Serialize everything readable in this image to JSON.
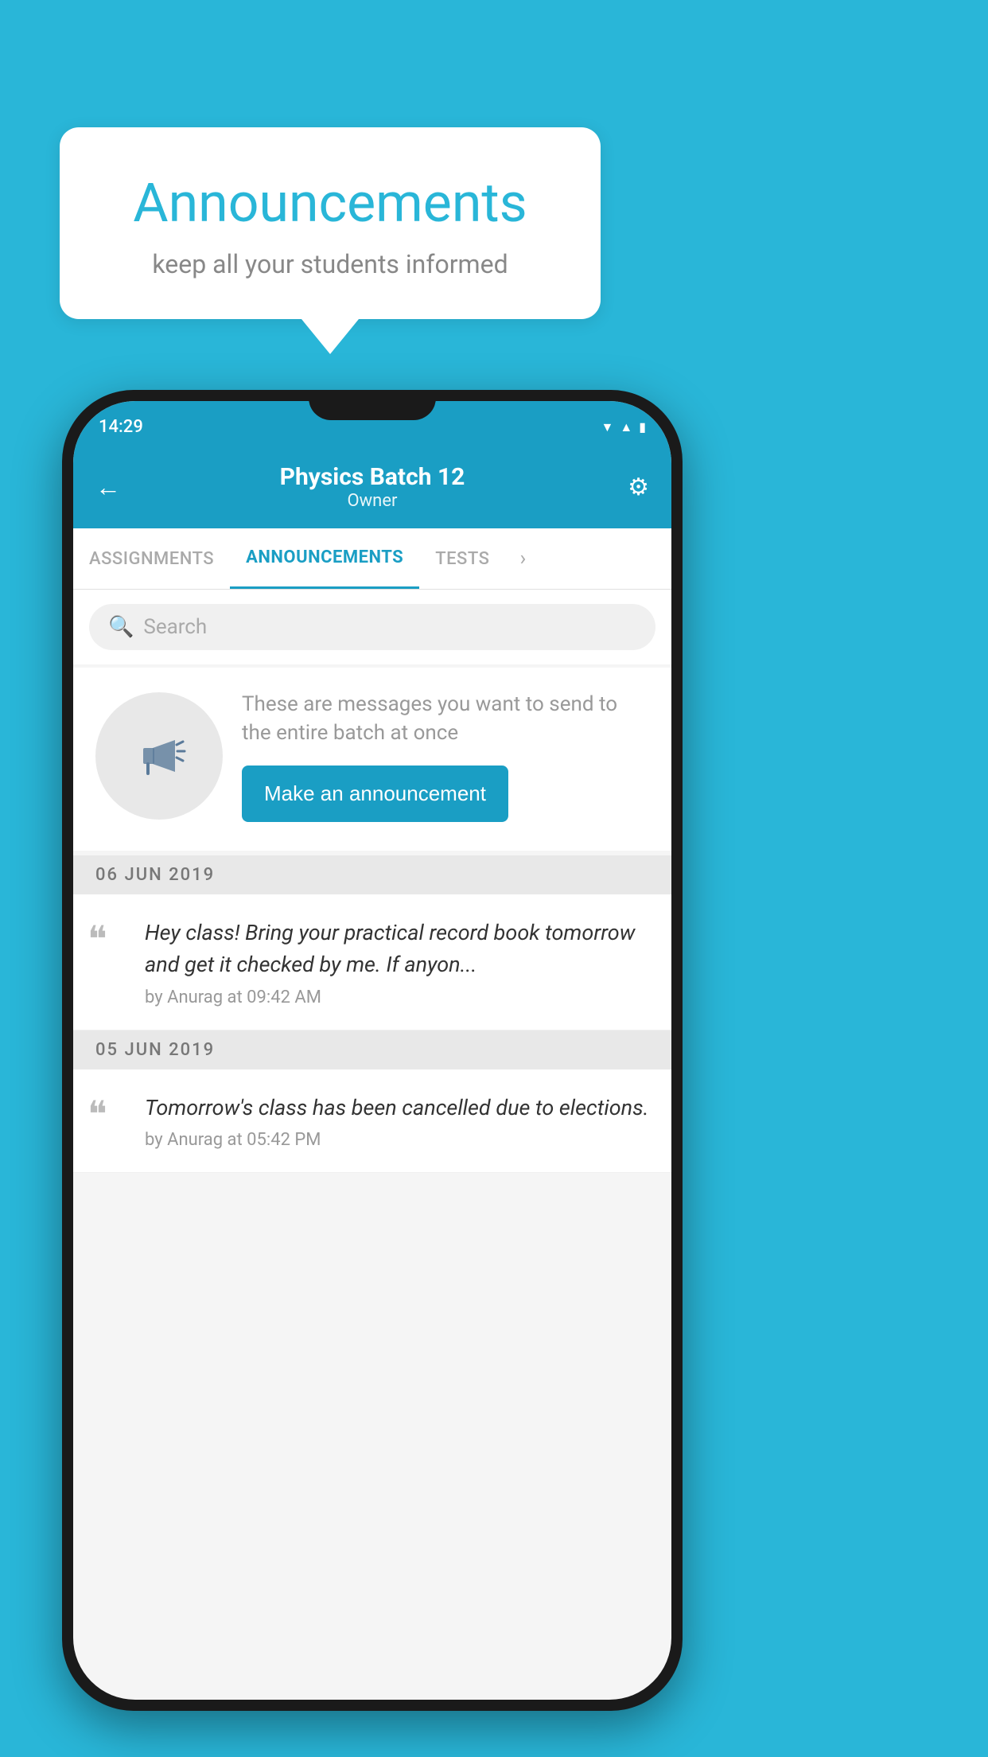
{
  "background_color": "#29b6d8",
  "speech_bubble": {
    "title": "Announcements",
    "subtitle": "keep all your students informed"
  },
  "phone": {
    "status_bar": {
      "time": "14:29"
    },
    "header": {
      "title": "Physics Batch 12",
      "subtitle": "Owner",
      "back_label": "←",
      "gear_label": "⚙"
    },
    "tabs": [
      {
        "label": "ASSIGNMENTS",
        "active": false
      },
      {
        "label": "ANNOUNCEMENTS",
        "active": true
      },
      {
        "label": "TESTS",
        "active": false
      }
    ],
    "search": {
      "placeholder": "Search"
    },
    "promo": {
      "description": "These are messages you want to send to the entire batch at once",
      "button_label": "Make an announcement"
    },
    "announcements": [
      {
        "date": "06  JUN  2019",
        "text": "Hey class! Bring your practical record book tomorrow and get it checked by me. If anyon...",
        "meta": "by Anurag at 09:42 AM"
      },
      {
        "date": "05  JUN  2019",
        "text": "Tomorrow's class has been cancelled due to elections.",
        "meta": "by Anurag at 05:42 PM"
      }
    ]
  }
}
